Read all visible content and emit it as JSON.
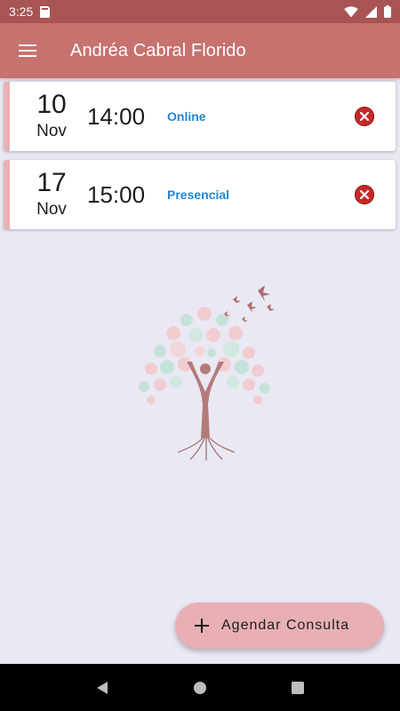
{
  "status_bar": {
    "time": "3:25",
    "icons": [
      "sd-card-icon",
      "wifi-icon",
      "signal-icon",
      "battery-icon"
    ]
  },
  "app_bar": {
    "title": "Andréa Cabral Florido",
    "menu_icon": "hamburger-menu-icon"
  },
  "appointments": [
    {
      "day": "10",
      "month": "Nov",
      "time": "14:00",
      "mode": "Online"
    },
    {
      "day": "17",
      "month": "Nov",
      "time": "15:00",
      "mode": "Presencial"
    }
  ],
  "fab": {
    "label": "Agendar Consulta",
    "icon": "plus-icon"
  },
  "nav_bar": {
    "icons": [
      "back-icon",
      "home-icon",
      "recents-icon"
    ]
  },
  "colors": {
    "status_bar": "#a85454",
    "app_bar": "#c6726f",
    "background": "#e9e8f3",
    "card_accent": "#eab1b6",
    "mode_text": "#1f86d3",
    "cancel": "#c62828",
    "fab": "#e8b0b5"
  }
}
